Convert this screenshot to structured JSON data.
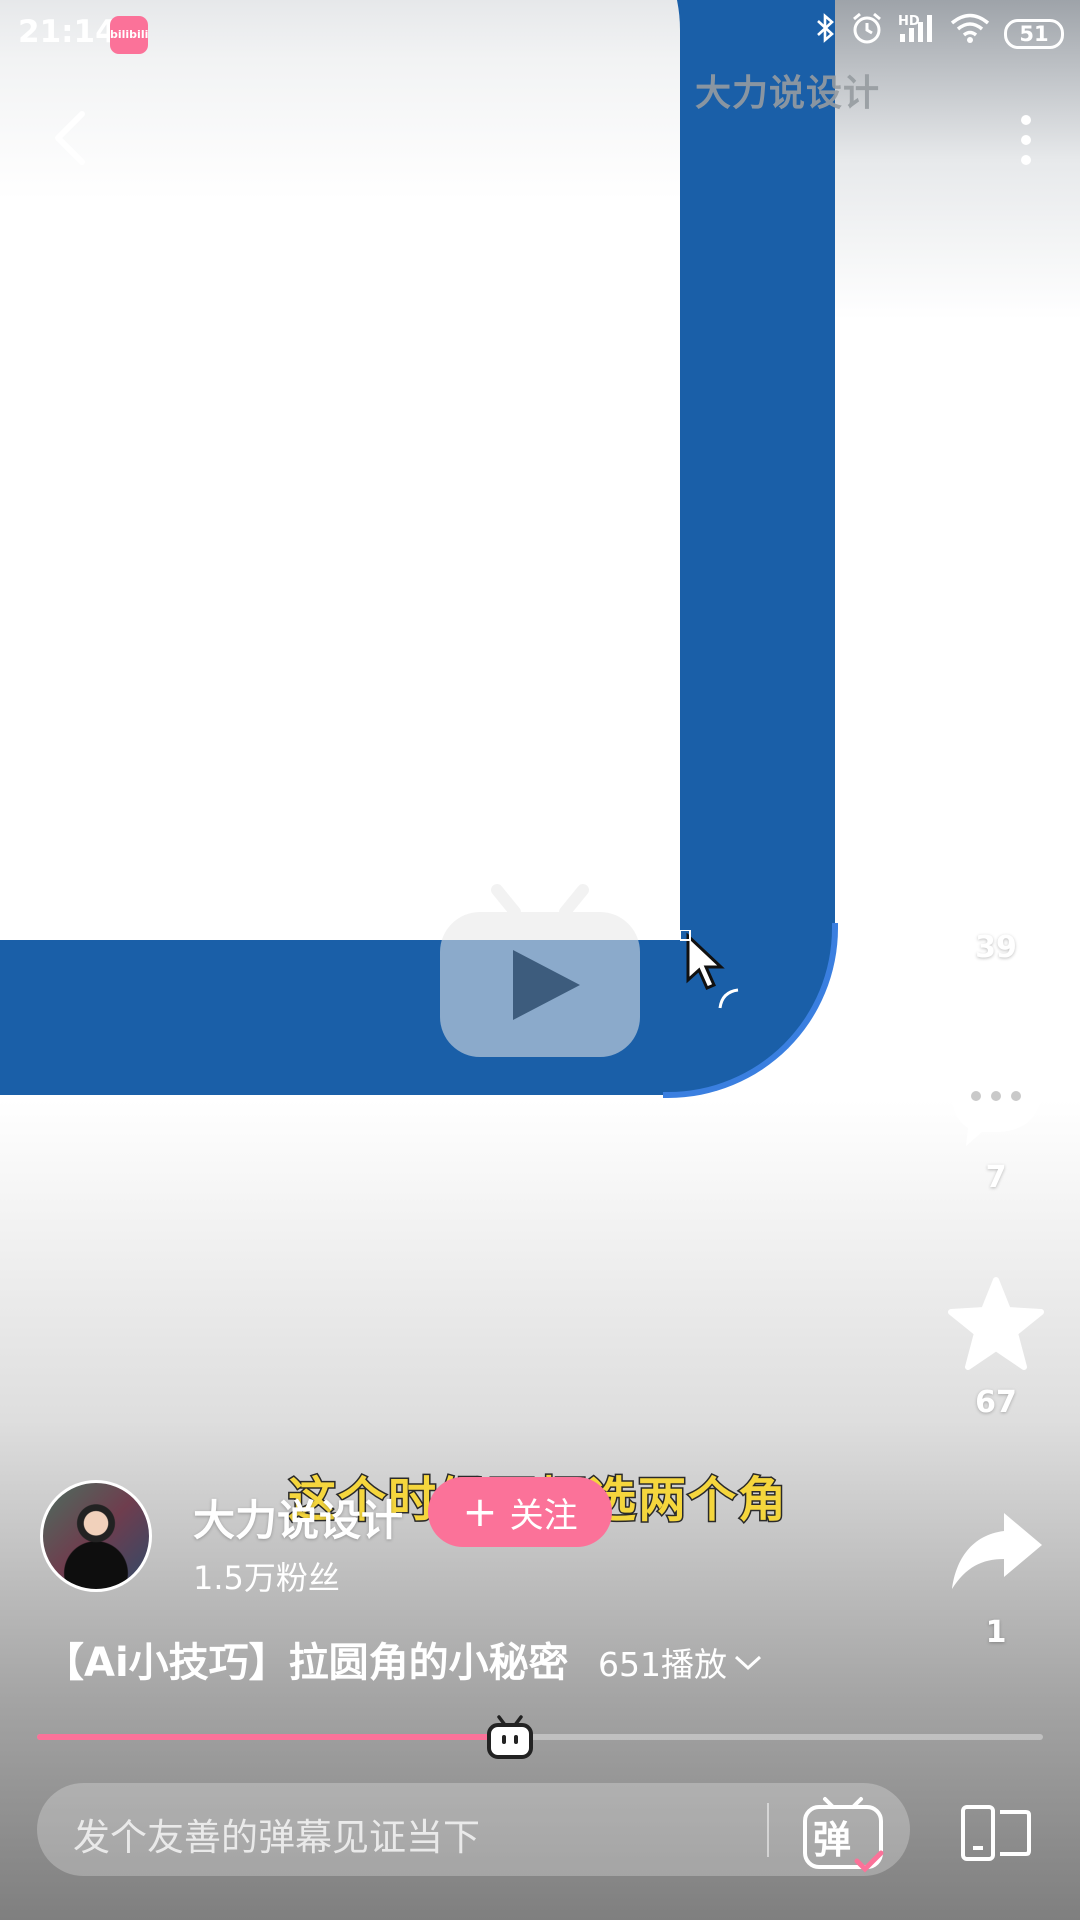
{
  "status_bar": {
    "time": "21:14",
    "app_badge": "bilibili",
    "hd_label": "HD",
    "battery": "51"
  },
  "video": {
    "watermark": "大力说设计",
    "subtitle": "这个时候再框选两个角"
  },
  "actions": {
    "like_count": "39",
    "comment_count": "7",
    "favorite_count": "67",
    "share_count": "1"
  },
  "author": {
    "name": "大力说设计",
    "fans": "1.5万粉丝",
    "follow_label": "关注"
  },
  "title": {
    "text": "【Ai小技巧】拉圆角的小秘密",
    "play_count": "651播放"
  },
  "progress": {
    "fraction": 0.47
  },
  "bottom_bar": {
    "danmaku_placeholder": "发个友善的弹幕见证当下",
    "danmaku_toggle_label": "弹"
  },
  "colors": {
    "accent": "#fb7299",
    "video_blue": "#1a5fa8",
    "subtitle_yellow": "#f5d63d"
  }
}
